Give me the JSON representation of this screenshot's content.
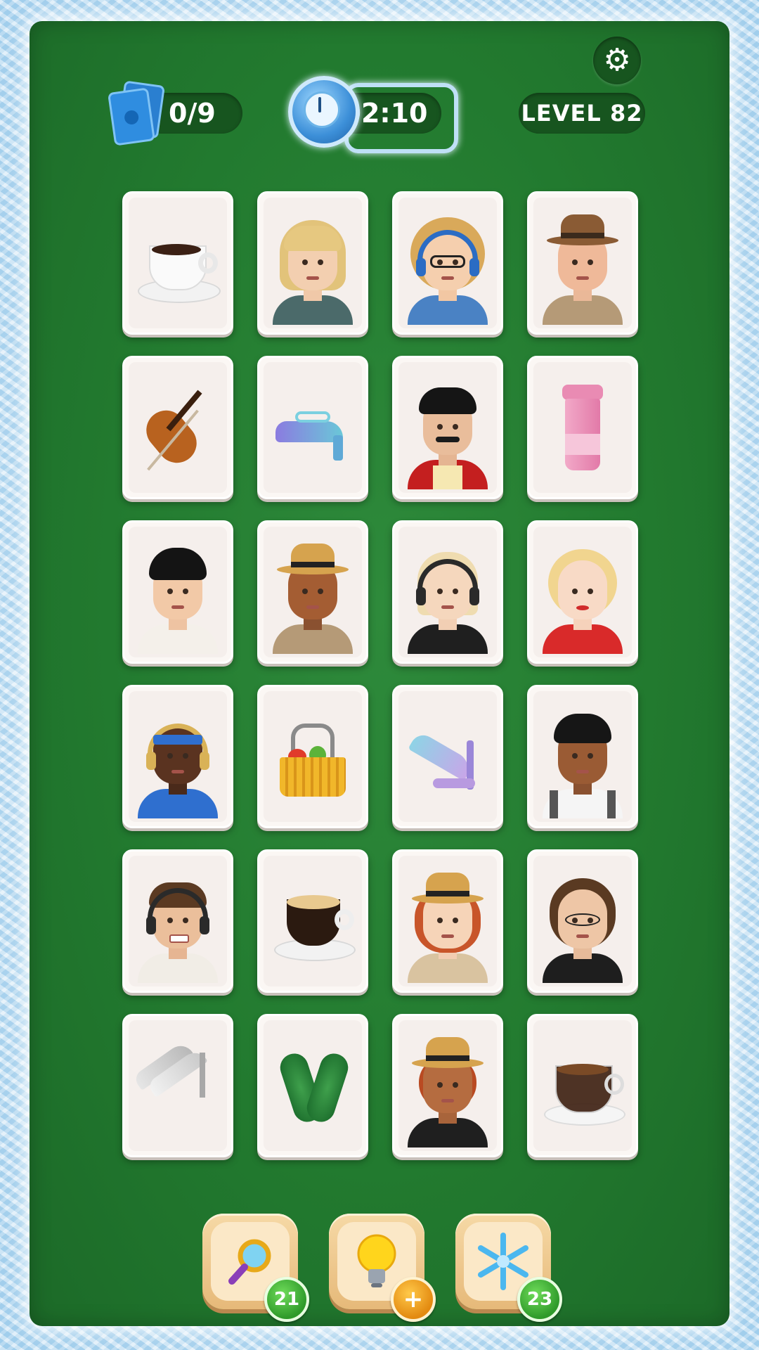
{
  "hud": {
    "cards_counter": "0/9",
    "timer": "02:10",
    "level": "LEVEL 82"
  },
  "icons": {
    "settings": "gear-icon",
    "cards": "card-stack-icon",
    "timer": "frozen-clock-icon"
  },
  "colors": {
    "board": "#227a2f",
    "pill": "#17551f",
    "frame": "#cfe6f5"
  },
  "grid": {
    "rows": 6,
    "columns": 4,
    "cards": [
      {
        "item": "coffee-cup"
      },
      {
        "item": "blonde-man-avatar"
      },
      {
        "item": "curly-hair-headphones-girl-avatar"
      },
      {
        "item": "old-man-brown-hat-avatar"
      },
      {
        "item": "violin"
      },
      {
        "item": "glitter-sandal"
      },
      {
        "item": "mustache-man-avatar"
      },
      {
        "item": "pink-travel-cup"
      },
      {
        "item": "black-hair-man-avatar"
      },
      {
        "item": "straw-hat-boy-avatar"
      },
      {
        "item": "blonde-headphones-girl-avatar"
      },
      {
        "item": "blonde-woman-red-lips-avatar"
      },
      {
        "item": "headband-headphones-man-avatar"
      },
      {
        "item": "shopping-basket"
      },
      {
        "item": "iridescent-high-heel"
      },
      {
        "item": "boy-backpack-avatar"
      },
      {
        "item": "headset-man-avatar"
      },
      {
        "item": "latte-cup"
      },
      {
        "item": "redhead-straw-hat-woman-avatar"
      },
      {
        "item": "round-glasses-man-avatar"
      },
      {
        "item": "silver-high-heels"
      },
      {
        "item": "green-glitter-flats"
      },
      {
        "item": "straw-hat-woman-avatar"
      },
      {
        "item": "espresso-glass-cup"
      }
    ]
  },
  "powerups": [
    {
      "name": "magnifier",
      "count": "21"
    },
    {
      "name": "lightbulb",
      "count": "+"
    },
    {
      "name": "freeze",
      "count": "23"
    }
  ]
}
